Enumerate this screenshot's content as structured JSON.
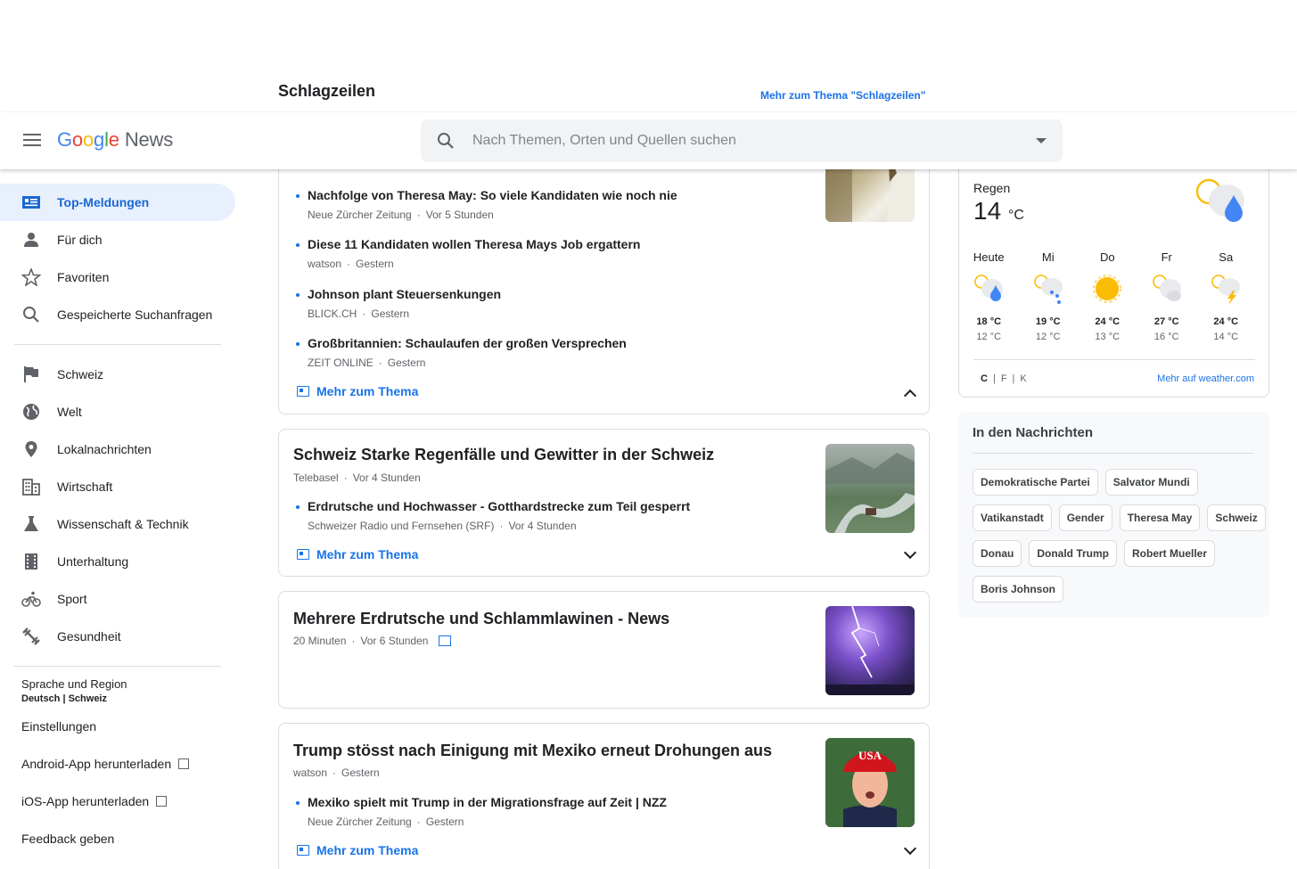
{
  "header": {
    "logo_letters": [
      "G",
      "o",
      "o",
      "g",
      "l",
      "e"
    ],
    "logo_suffix": "News",
    "search_placeholder": "Nach Themen, Orten und Quellen suchen"
  },
  "section": {
    "title": "Schlagzeilen",
    "more_link": "Mehr zum Thema \"Schlagzeilen\""
  },
  "sidebar": {
    "main": [
      {
        "label": "Top-Meldungen",
        "icon": "headlines-icon"
      },
      {
        "label": "Für dich",
        "icon": "person-icon"
      },
      {
        "label": "Favoriten",
        "icon": "star-icon"
      },
      {
        "label": "Gespeicherte Suchanfragen",
        "icon": "search-icon"
      }
    ],
    "topics": [
      {
        "label": "Schweiz",
        "icon": "flag-icon"
      },
      {
        "label": "Welt",
        "icon": "globe-icon"
      },
      {
        "label": "Lokalnachrichten",
        "icon": "location-pin-icon"
      },
      {
        "label": "Wirtschaft",
        "icon": "building-icon"
      },
      {
        "label": "Wissenschaft & Technik",
        "icon": "flask-icon"
      },
      {
        "label": "Unterhaltung",
        "icon": "film-icon"
      },
      {
        "label": "Sport",
        "icon": "bicycle-icon"
      },
      {
        "label": "Gesundheit",
        "icon": "dumbbell-icon"
      }
    ],
    "language_label": "Sprache und Region",
    "language_value": "Deutsch | Schweiz",
    "settings": "Einstellungen",
    "android": "Android-App herunterladen",
    "ios": "iOS-App herunterladen",
    "feedback": "Feedback geben"
  },
  "cards": {
    "c1": {
      "subs": [
        {
          "title": "Nachfolge von Theresa May: So viele Kandidaten wie noch nie",
          "source": "Neue Zürcher Zeitung",
          "time": "Vor 5 Stunden"
        },
        {
          "title": "Diese 11 Kandidaten wollen Theresa Mays Job ergattern",
          "source": "watson",
          "time": "Gestern"
        },
        {
          "title": "Johnson plant Steuersenkungen",
          "source": "BLICK.CH",
          "time": "Gestern"
        },
        {
          "title": "Großbritannien: Schaulaufen der großen Versprechen",
          "source": "ZEIT ONLINE",
          "time": "Gestern"
        }
      ],
      "more": "Mehr zum Thema"
    },
    "c2": {
      "title": "Schweiz Starke Regenfälle und Gewitter in der Schweiz",
      "source": "Telebasel",
      "time": "Vor 4 Stunden",
      "subs": [
        {
          "title": "Erdrutsche und Hochwasser - Gotthardstrecke zum Teil gesperrt",
          "source": "Schweizer Radio und Fernsehen (SRF)",
          "time": "Vor 4 Stunden"
        }
      ],
      "more": "Mehr zum Thema"
    },
    "c3": {
      "title": "Mehrere Erdrutsche und Schlammlawinen - News",
      "source": "20 Minuten",
      "time": "Vor 6 Stunden"
    },
    "c4": {
      "title": "Trump stösst nach Einigung mit Mexiko erneut Drohungen aus",
      "source": "watson",
      "time": "Gestern",
      "subs": [
        {
          "title": "Mexiko spielt mit Trump in der Migrationsfrage auf Zeit | NZZ",
          "source": "Neue Zürcher Zeitung",
          "time": "Gestern"
        }
      ],
      "more": "Mehr zum Thema",
      "hat_text": "USA"
    }
  },
  "weather": {
    "condition": "Regen",
    "temp": "14",
    "unit": "°C",
    "forecast": [
      {
        "day": "Heute",
        "hi": "18 °C",
        "lo": "12 °C",
        "icon": "rain-icon"
      },
      {
        "day": "Mi",
        "hi": "19 °C",
        "lo": "12 °C",
        "icon": "drizzle-icon"
      },
      {
        "day": "Do",
        "hi": "24 °C",
        "lo": "13 °C",
        "icon": "sun-icon"
      },
      {
        "day": "Fr",
        "hi": "27 °C",
        "lo": "16 °C",
        "icon": "partly-cloudy-icon"
      },
      {
        "day": "Sa",
        "hi": "24 °C",
        "lo": "14 °C",
        "icon": "thunderstorm-icon"
      }
    ],
    "units": [
      "C",
      "F",
      "K"
    ],
    "more": "Mehr auf weather.com"
  },
  "trending": {
    "title": "In den Nachrichten",
    "chips": [
      "Demokratische Partei",
      "Salvator Mundi",
      "Vatikanstadt",
      "Gender",
      "Theresa May",
      "Schweiz",
      "Donau",
      "Donald Trump",
      "Robert Mueller",
      "Boris Johnson"
    ]
  }
}
